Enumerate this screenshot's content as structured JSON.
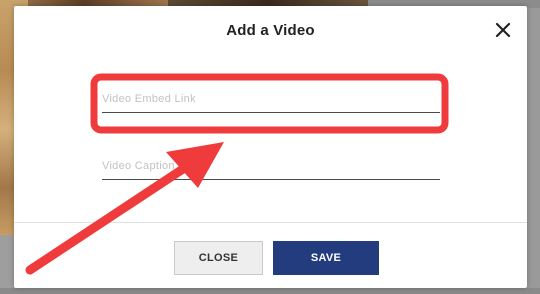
{
  "modal": {
    "title": "Add a Video",
    "fields": {
      "embed_link_placeholder": "Video Embed Link",
      "caption_placeholder": "Video Caption"
    },
    "buttons": {
      "close_label": "CLOSE",
      "save_label": "SAVE"
    }
  },
  "colors": {
    "annotation_red": "#ef3b3b",
    "save_button": "#233c7e"
  },
  "icons": {
    "close": "close-icon"
  }
}
